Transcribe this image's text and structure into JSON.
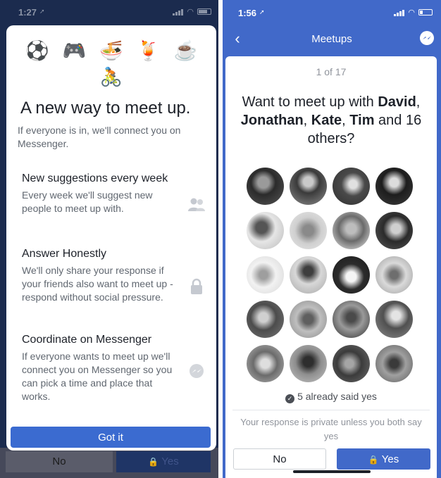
{
  "left": {
    "status": {
      "time": "1:27",
      "arrow": "➚"
    },
    "emojis_row1": [
      "⚽",
      "🎮",
      "🍜",
      "🍹",
      "☕"
    ],
    "emoji_row2": "🚴",
    "title": "A new way to meet up.",
    "subtitle": "If everyone is in, we'll connect you on Messenger.",
    "features": [
      {
        "title": "New suggestions every week",
        "desc": "Every week we'll suggest new people to meet up with.",
        "icon": "people-icon"
      },
      {
        "title": "Answer Honestly",
        "desc": "We'll only share your response if your friends also want to meet up - respond without social pressure.",
        "icon": "lock-icon"
      },
      {
        "title": "Coordinate on Messenger",
        "desc": "If everyone wants to meet up we'll connect you on Messenger so you can pick a time and place that works.",
        "icon": "messenger-icon"
      }
    ],
    "got_it_label": "Got it",
    "bg_no_label": "No",
    "bg_yes_label": "Yes"
  },
  "right": {
    "status": {
      "time": "1:56",
      "arrow": "➚"
    },
    "nav_title": "Meetups",
    "counter": "1 of 17",
    "question_prefix": "Want to meet up with ",
    "names": [
      "David",
      "Jonathan",
      "Kate",
      "Tim"
    ],
    "question_suffix": " and 16 others?",
    "already_said": "5 already said yes",
    "private_note": "Your response is private unless you both say yes",
    "no_label": "No",
    "yes_label": "Yes",
    "photo_count": 20
  },
  "colors": {
    "facebook_blue": "#4169c9",
    "button_blue": "#3b6bd0",
    "dark_overlay": "#1b2b4e"
  }
}
